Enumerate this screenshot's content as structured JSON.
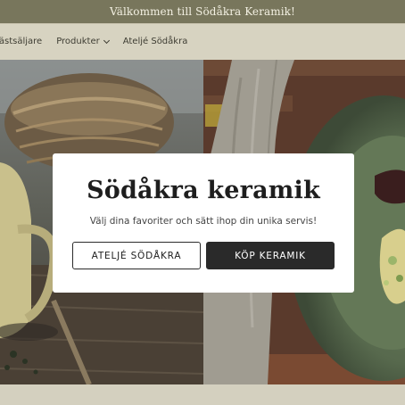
{
  "announcement": {
    "text": "Välkommen till Södåkra Keramik!"
  },
  "nav": {
    "items": [
      {
        "label": "Bästsäljare",
        "has_dropdown": false
      },
      {
        "label": "Produkter",
        "has_dropdown": true
      },
      {
        "label": "Ateljé Södåkra",
        "has_dropdown": false
      }
    ]
  },
  "hero": {
    "left_image": "ceramic cup on wooden table with woven basket",
    "right_image": "green ceramic plate with food on linen cloth"
  },
  "modal": {
    "title": "Södåkra keramik",
    "subtitle": "Välj dina favoriter och sätt ihop din unika servis!",
    "secondary_button": "ATELJÉ SÖDÅKRA",
    "primary_button": "KÖP KERAMIK"
  },
  "colors": {
    "announcement_bg": "#78765c",
    "header_bg": "#d7d3c1",
    "primary_button": "#2a2a2a"
  }
}
